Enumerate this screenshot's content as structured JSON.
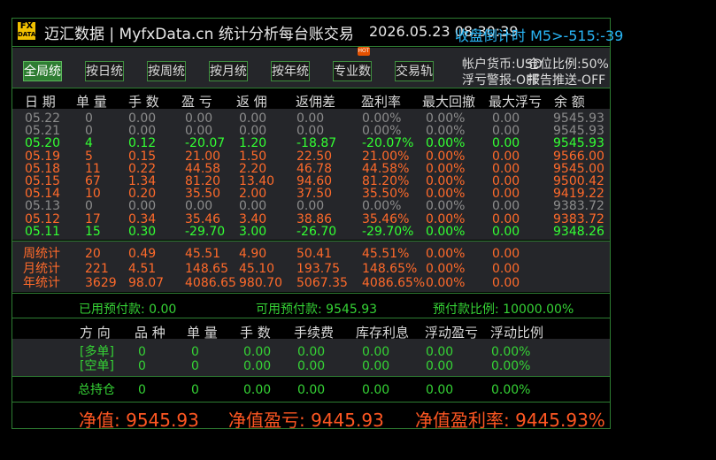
{
  "header": {
    "logo_top": "FX",
    "logo_bottom": "DATA",
    "app_title": "迈汇数据 | MyfxData.cn  统计分析每台账交易",
    "server_time": "2026.05.23 08:30:39",
    "symbol_info": "收盘倒计时  M5>-515:-39"
  },
  "tabs": [
    {
      "label": "全局统计",
      "active": true
    },
    {
      "label": "按日统计",
      "active": false
    },
    {
      "label": "按周统计",
      "active": false
    },
    {
      "label": "按月统计",
      "active": false
    },
    {
      "label": "按年统计",
      "active": false
    },
    {
      "label": "专业数据",
      "active": false
    },
    {
      "label": "交易轨迹",
      "active": false
    }
  ],
  "hot_badge": "HOT",
  "account_meta": {
    "currency": "帐户货币:USD",
    "position_ratio": "仓位比例:50%",
    "loss_alert": "浮亏警报-OFF",
    "report_push": "报告推送-OFF"
  },
  "columns": [
    "日 期",
    "单 量",
    "手 数",
    "盈 亏",
    "返 佣",
    "返佣差",
    "盈利率",
    "最大回撤",
    "最大浮亏",
    "余 额"
  ],
  "daily_rows": [
    {
      "date": "05.22",
      "vol": "0",
      "lots": "0.00",
      "pl": "0.00",
      "rebate": "0.00",
      "diff": "0.00",
      "rate": "0.00%",
      "dd": "0.00%",
      "float": "0.00",
      "balance": "9545.93",
      "tone": "gray"
    },
    {
      "date": "05.21",
      "vol": "0",
      "lots": "0.00",
      "pl": "0.00",
      "rebate": "0.00",
      "diff": "0.00",
      "rate": "0.00%",
      "dd": "0.00%",
      "float": "0.00",
      "balance": "9545.93",
      "tone": "gray"
    },
    {
      "date": "05.20",
      "vol": "4",
      "lots": "0.12",
      "pl": "-20.07",
      "rebate": "1.20",
      "diff": "-18.87",
      "rate": "-20.07%",
      "dd": "0.00%",
      "float": "0.00",
      "balance": "9545.93",
      "tone": "green"
    },
    {
      "date": "05.19",
      "vol": "5",
      "lots": "0.15",
      "pl": "21.00",
      "rebate": "1.50",
      "diff": "22.50",
      "rate": "21.00%",
      "dd": "0.00%",
      "float": "0.00",
      "balance": "9566.00",
      "tone": "orange"
    },
    {
      "date": "05.18",
      "vol": "11",
      "lots": "0.22",
      "pl": "44.58",
      "rebate": "2.20",
      "diff": "46.78",
      "rate": "44.58%",
      "dd": "0.00%",
      "float": "0.00",
      "balance": "9545.00",
      "tone": "orange"
    },
    {
      "date": "05.15",
      "vol": "67",
      "lots": "1.34",
      "pl": "81.20",
      "rebate": "13.40",
      "diff": "94.60",
      "rate": "81.20%",
      "dd": "0.00%",
      "float": "0.00",
      "balance": "9500.42",
      "tone": "orange"
    },
    {
      "date": "05.14",
      "vol": "10",
      "lots": "0.20",
      "pl": "35.50",
      "rebate": "2.00",
      "diff": "37.50",
      "rate": "35.50%",
      "dd": "0.00%",
      "float": "0.00",
      "balance": "9419.22",
      "tone": "orange"
    },
    {
      "date": "05.13",
      "vol": "0",
      "lots": "0.00",
      "pl": "0.00",
      "rebate": "0.00",
      "diff": "0.00",
      "rate": "0.00%",
      "dd": "0.00%",
      "float": "0.00",
      "balance": "9383.72",
      "tone": "gray"
    },
    {
      "date": "05.12",
      "vol": "17",
      "lots": "0.34",
      "pl": "35.46",
      "rebate": "3.40",
      "diff": "38.86",
      "rate": "35.46%",
      "dd": "0.00%",
      "float": "0.00",
      "balance": "9383.72",
      "tone": "orange"
    },
    {
      "date": "05.11",
      "vol": "15",
      "lots": "0.30",
      "pl": "-29.70",
      "rebate": "3.00",
      "diff": "-26.70",
      "rate": "-29.70%",
      "dd": "0.00%",
      "float": "0.00",
      "balance": "9348.26",
      "tone": "green"
    }
  ],
  "period_rows": [
    {
      "date": "周统计",
      "vol": "20",
      "lots": "0.49",
      "pl": "45.51",
      "rebate": "4.90",
      "diff": "50.41",
      "rate": "45.51%",
      "dd": "0.00%",
      "float": "0.00"
    },
    {
      "date": "月统计",
      "vol": "221",
      "lots": "4.51",
      "pl": "148.65",
      "rebate": "45.10",
      "diff": "193.75",
      "rate": "148.65%",
      "dd": "0.00%",
      "float": "0.00"
    },
    {
      "date": "年统计",
      "vol": "3629",
      "lots": "98.07",
      "pl": "4086.65",
      "rebate": "980.70",
      "diff": "5067.35",
      "rate": "4086.65%",
      "dd": "0.00%",
      "float": "0.00"
    }
  ],
  "prepayment": {
    "used": "已用预付款:  0.00",
    "available": "可用预付款:  9545.93",
    "ratio": "预付款比例:  10000.00%"
  },
  "position_columns": [
    "方 向",
    "品 种",
    "单 量",
    "手 数",
    "手续费",
    "库存利息",
    "浮动盈亏",
    "浮动比例"
  ],
  "position_rows": [
    {
      "dir": "[多单]",
      "kind": "0",
      "vol": "0",
      "lots": "0.00",
      "fee": "0.00",
      "swap": "0.00",
      "fpl": "0.00",
      "fpct": "0.00%"
    },
    {
      "dir": "[空单]",
      "kind": "0",
      "vol": "0",
      "lots": "0.00",
      "fee": "0.00",
      "swap": "0.00",
      "fpl": "0.00",
      "fpct": "0.00%"
    }
  ],
  "total_row": {
    "dir": "总持仓",
    "kind": "0",
    "vol": "0",
    "lots": "0.00",
    "fee": "0.00",
    "swap": "0.00",
    "fpl": "0.00",
    "fpct": "0.00%"
  },
  "summary": {
    "net_value": "净值: 9545.93",
    "net_pl": "净值盈亏: 9445.93",
    "net_rate": "净值盈利率: 9445.93%"
  },
  "colors": {
    "profit": "#ff6a2a",
    "loss": "#33ff33",
    "neutral": "#8c8c8c",
    "accent": "#29b6f6",
    "border": "#2e7d32"
  }
}
